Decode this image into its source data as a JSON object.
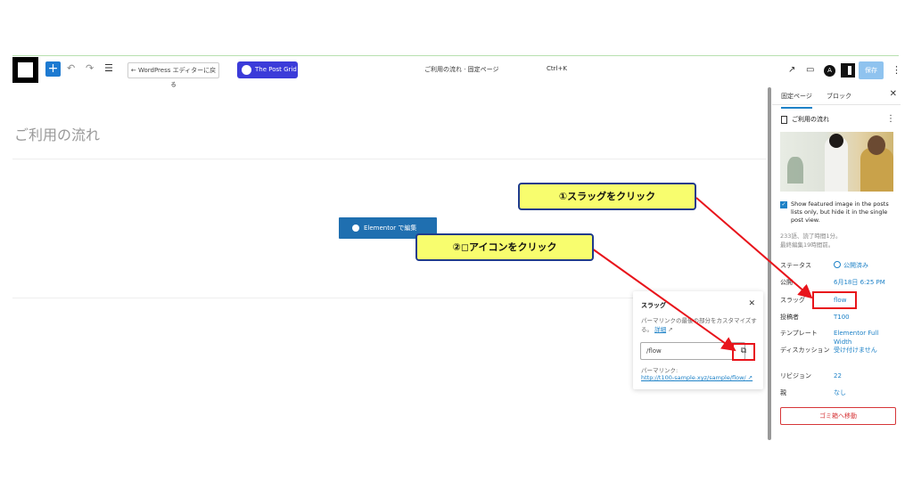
{
  "toolbar": {
    "back_label": "← WordPress エディターに戻る",
    "postgrid_label": "The Post Grid",
    "doc_title": "ご利用の流れ · 固定ページ",
    "shortcut": "Ctrl+K",
    "astra_letter": "A",
    "save_label": "保存"
  },
  "canvas": {
    "page_heading": "ご利用の流れ",
    "elementor_label": "Elementor で編集"
  },
  "panel": {
    "tab_page": "固定ページ",
    "tab_block": "ブロック",
    "page_title": "ご利用の流れ",
    "featured_checkbox": "Show featured image in the posts lists only, but hide it in the single post view.",
    "meta_note_1": "233語、読了時間1分。",
    "meta_note_2": "最終編集19時間前。",
    "props": [
      {
        "label": "ステータス",
        "value": "公開済み"
      },
      {
        "label": "公開",
        "value": "6月18日 6:25 PM"
      },
      {
        "label": "スラッグ",
        "value": "flow"
      },
      {
        "label": "投稿者",
        "value": "T100"
      },
      {
        "label": "テンプレート",
        "value": "Elementor Full Width"
      },
      {
        "label": "ディスカッション",
        "value": "受け付けません"
      },
      {
        "label": "リビジョン",
        "value": "22"
      },
      {
        "label": "親",
        "value": "なし"
      }
    ],
    "trash_label": "ゴミ箱へ移動"
  },
  "slug_popover": {
    "title": "スラッグ",
    "desc": "パーマリンクの最後の部分をカスタマイズする。",
    "desc_link": "詳細",
    "input_value": "/flow",
    "permalink_label": "パーマリンク:",
    "permalink_url": "http://t100-sample.xyz/sample/flow/"
  },
  "annotations": {
    "callout_1": "①スラッグをクリック",
    "callout_2": "②◻アイコンをクリック"
  },
  "colors": {
    "accent": "#1e82c7",
    "annotation_red": "#e8141b",
    "callout_fill": "#f8fd6e"
  }
}
